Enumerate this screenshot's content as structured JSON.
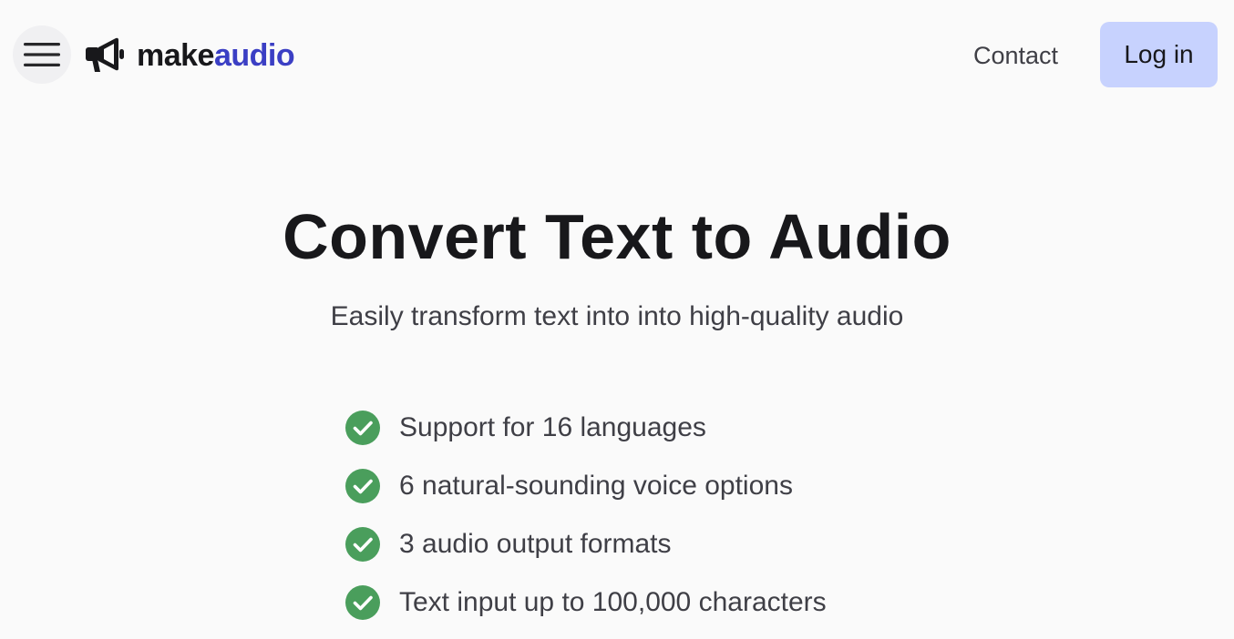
{
  "header": {
    "menu_icon": "hamburger-menu-icon",
    "logo": {
      "icon": "megaphone-icon",
      "text_primary": "make",
      "text_accent": "audio",
      "accent_color": "#3b3fc4"
    },
    "nav": {
      "contact_label": "Contact",
      "login_label": "Log in",
      "login_bg_color": "#c7d2fe"
    }
  },
  "hero": {
    "title": "Convert Text to Audio",
    "subtitle": "Easily transform text into into high-quality audio"
  },
  "features": {
    "icon": "check-circle-icon",
    "icon_color": "#4a9e5c",
    "items": [
      {
        "label": "Support for 16 languages"
      },
      {
        "label": "6 natural-sounding voice options"
      },
      {
        "label": "3 audio output formats"
      },
      {
        "label": "Text input up to 100,000 characters"
      }
    ]
  }
}
